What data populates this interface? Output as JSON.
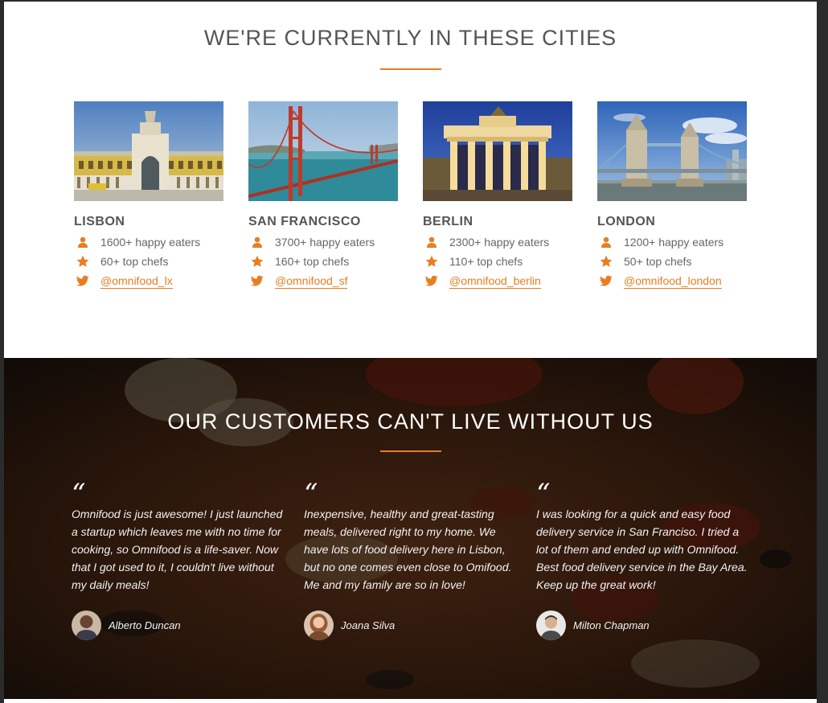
{
  "cities_section": {
    "title": "WE'RE CURRENTLY IN THESE CITIES",
    "accent_color": "#e67e22",
    "cities": [
      {
        "name": "LISBON",
        "eaters": "1600+ happy eaters",
        "chefs": "60+ top chefs",
        "twitter": "@omnifood_lx"
      },
      {
        "name": "SAN FRANCISCO",
        "eaters": "3700+ happy eaters",
        "chefs": "160+ top chefs",
        "twitter": "@omnifood_sf"
      },
      {
        "name": "BERLIN",
        "eaters": "2300+ happy eaters",
        "chefs": "110+ top chefs",
        "twitter": "@omnifood_berlin"
      },
      {
        "name": "LONDON",
        "eaters": "1200+ happy eaters",
        "chefs": "50+ top chefs",
        "twitter": "@omnifood_london"
      }
    ],
    "icons": {
      "eaters": "person-icon",
      "chefs": "star-icon",
      "twitter": "twitter-icon"
    }
  },
  "testimonials_section": {
    "title": "OUR CUSTOMERS CAN'T LIVE WITHOUT US",
    "quote_mark": "“",
    "testimonials": [
      {
        "text": "Omnifood is just awesome! I just launched a startup which leaves me with no time for cooking, so Omnifood is a life-saver. Now that I got used to it, I couldn't live without my daily meals!",
        "author": "Alberto Duncan"
      },
      {
        "text": "Inexpensive, healthy and great-tasting meals, delivered right to my home. We have lots of food delivery here in Lisbon, but no one comes even close to Omifood. Me and my family are so in love!",
        "author": "Joana Silva"
      },
      {
        "text": "I was looking for a quick and easy food delivery service in San Franciso. I tried a lot of them and ended up with Omnifood. Best food delivery service in the Bay Area. Keep up the great work!",
        "author": "Milton Chapman"
      }
    ]
  }
}
